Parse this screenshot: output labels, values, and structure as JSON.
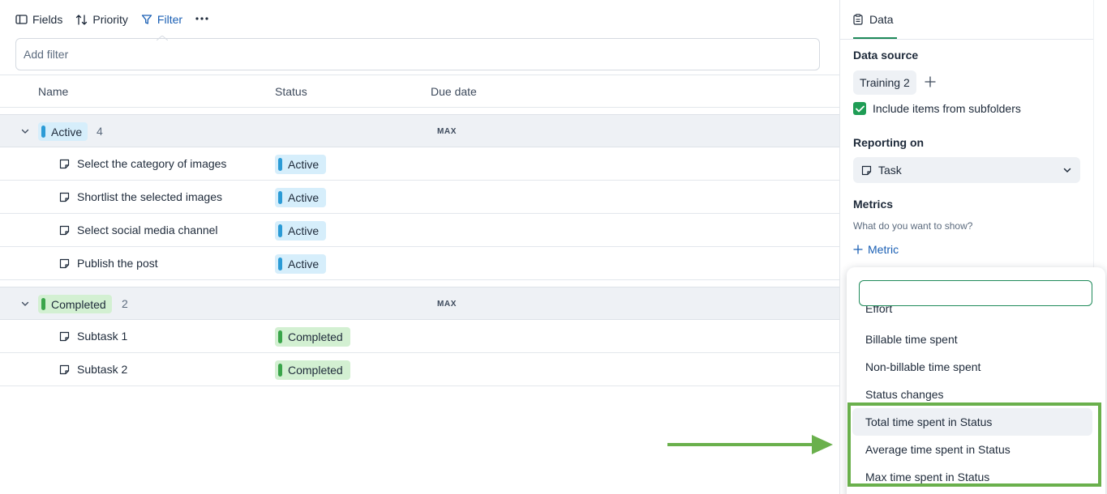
{
  "toolbar": {
    "fields_label": "Fields",
    "priority_label": "Priority",
    "filter_label": "Filter",
    "more_label": "···"
  },
  "filter": {
    "placeholder": "Add filter"
  },
  "columns": {
    "name": "Name",
    "status": "Status",
    "due_date": "Due date"
  },
  "groups": [
    {
      "label": "Active",
      "count": "4",
      "max_label": "MAX",
      "color": "#2b9bd6",
      "tasks": [
        {
          "name": "Select the category of images",
          "status": "Active"
        },
        {
          "name": "Shortlist the selected images",
          "status": "Active"
        },
        {
          "name": "Select social media channel",
          "status": "Active"
        },
        {
          "name": "Publish the post",
          "status": "Active"
        }
      ]
    },
    {
      "label": "Completed",
      "count": "2",
      "max_label": "MAX",
      "color": "#3aa54a",
      "tasks": [
        {
          "name": "Subtask 1",
          "status": "Completed"
        },
        {
          "name": "Subtask 2",
          "status": "Completed"
        }
      ]
    }
  ],
  "panel": {
    "tab_label": "Data",
    "data_source_heading": "Data source",
    "source_chip": "Training 2",
    "include_subfolders_label": "Include items from subfolders",
    "include_subfolders_checked": true,
    "reporting_heading": "Reporting on",
    "reporting_value": "Task",
    "metrics_heading": "Metrics",
    "metrics_hint": "What do you want to show?",
    "metric_add_label": "Metric"
  },
  "dropdown": {
    "search_value": "",
    "items": [
      "Effort",
      "Billable time spent",
      "Non-billable time spent",
      "Status changes",
      "Total time spent in Status",
      "Average time spent in Status",
      "Max time spent in Status"
    ],
    "highlighted_item": "Total time spent in Status"
  },
  "annotation_color": "#6ab04c",
  "accent_color": "#1f8a5a"
}
